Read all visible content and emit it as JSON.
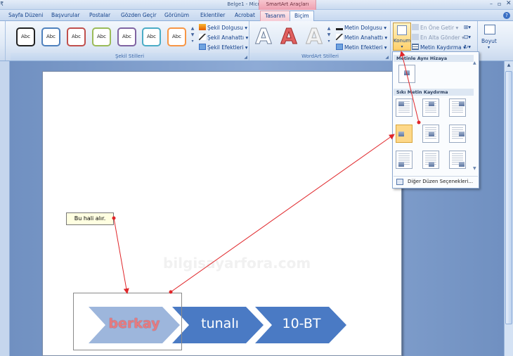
{
  "window": {
    "title": "Belge1 - Microsoft Word",
    "context_group": "SmartArt Araçları",
    "min": "–",
    "max": "▫",
    "close": "✕",
    "left_glyph": "₹"
  },
  "tabs": [
    {
      "label": "Sayfa Düzeni"
    },
    {
      "label": "Başvurular"
    },
    {
      "label": "Postalar"
    },
    {
      "label": "Gözden Geçir"
    },
    {
      "label": "Görünüm"
    },
    {
      "label": "Eklentiler"
    },
    {
      "label": "Acrobat"
    },
    {
      "label": "Tasarım"
    },
    {
      "label": "Biçim"
    }
  ],
  "help": "?",
  "ribbon": {
    "shape_styles": {
      "group_label": "Şekil Stilleri",
      "style_text": "Abc",
      "style_colors": [
        "#222222",
        "#4f81bd",
        "#c0504d",
        "#9bbb59",
        "#8064a2",
        "#4bacc6",
        "#f79646"
      ],
      "fill": "Şekil Dolgusu",
      "outline": "Şekil Anahattı",
      "effects": "Şekil Efektleri"
    },
    "wordart_styles": {
      "group_label": "WordArt Stilleri",
      "letter": "A",
      "fill": "Metin Dolgusu",
      "outline": "Metin Anahattı",
      "effects": "Metin Efektleri"
    },
    "arrange": {
      "position": "Konum",
      "bring_front": "En Öne Getir",
      "send_back": "En Alta Gönder",
      "text_wrap": "Metin Kaydırma"
    },
    "size": {
      "label": "Boyut"
    }
  },
  "dropdown": {
    "section1": "Metinle Aynı Hizaya",
    "section2": "Sıkı Metin Kaydırma",
    "more": "Diğer Düzen Seçenekleri..."
  },
  "document": {
    "watermark": "bilgisayarfora.com",
    "smartart": [
      "berkay",
      "tunalı",
      "10-BT"
    ],
    "callout": "Bu hali alır."
  },
  "colors": {
    "chevron_light": "#9db6dc",
    "chevron_dark": "#4a7ac4",
    "arrow": "#e0262a"
  }
}
